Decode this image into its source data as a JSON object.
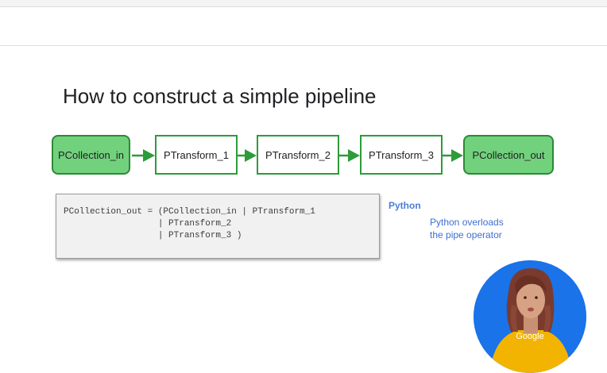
{
  "title": "How to construct a simple pipeline",
  "pipeline": {
    "nodes": [
      {
        "label": "PCollection_in",
        "kind": "pcollection"
      },
      {
        "label": "PTransform_1",
        "kind": "ptransform"
      },
      {
        "label": "PTransform_2",
        "kind": "ptransform"
      },
      {
        "label": "PTransform_3",
        "kind": "ptransform"
      },
      {
        "label": "PCollection_out",
        "kind": "pcollection"
      }
    ],
    "colors": {
      "pcollection_fill": "#72d17c",
      "border": "#2e9b3a",
      "arrow": "#2e9b3a"
    }
  },
  "code": {
    "lines": [
      "PCollection_out = (PCollection_in | PTransform_1",
      "                  | PTransform_2",
      "                  | PTransform_3 )"
    ]
  },
  "language_label": "Python",
  "note": {
    "line1": "Python overloads",
    "line2": "the pipe operator"
  },
  "presenter": {
    "shirt_text": "Google"
  }
}
